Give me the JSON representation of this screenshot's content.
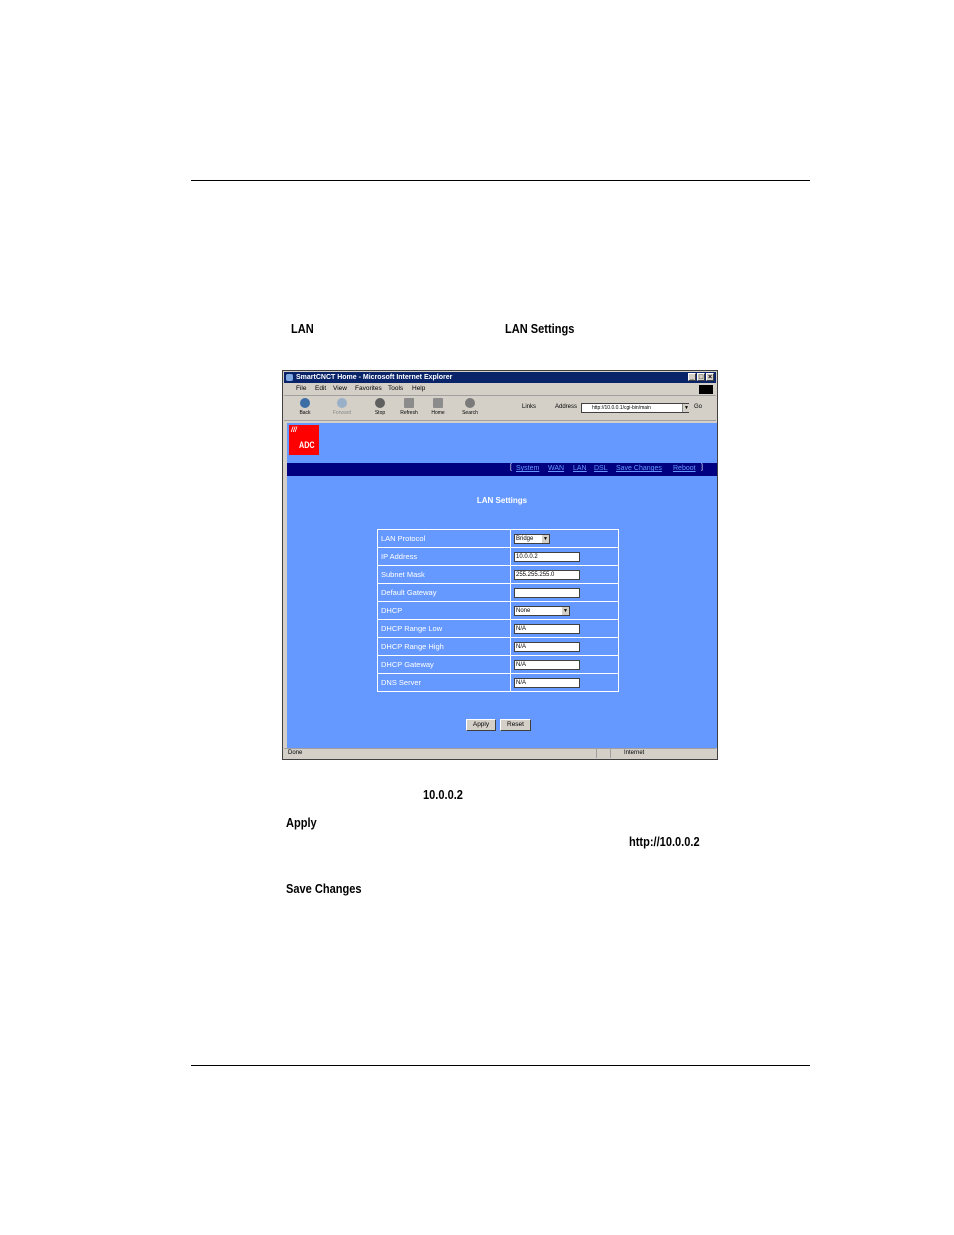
{
  "document": {
    "label_lan": "LAN",
    "label_lan_settings": "LAN Settings",
    "ip_value": "10.0.0.2",
    "apply": "Apply",
    "url": "http://10.0.0.2",
    "save_changes": "Save Changes"
  },
  "browser": {
    "title": "SmartCNCT Home - Microsoft Internet Explorer",
    "menu": [
      "File",
      "Edit",
      "View",
      "Favorites",
      "Tools",
      "Help"
    ],
    "toolbar": {
      "back": "Back",
      "forward": "Forward",
      "stop": "Stop",
      "refresh": "Refresh",
      "home": "Home",
      "search": "Search"
    },
    "links": "Links",
    "address_label": "Address",
    "address": "http://10.0.0.1/cgi-bin/main",
    "go": "Go",
    "status": "Done",
    "zone": "Internet"
  },
  "page": {
    "logo": "ADC",
    "nav": [
      "System",
      "WAN",
      "LAN",
      "DSL",
      "Save Changes",
      "Reboot"
    ],
    "title": "LAN Settings",
    "rows": [
      {
        "label": "LAN Protocol",
        "value": "Bridge",
        "kind": "select"
      },
      {
        "label": "IP Address",
        "value": "10.0.0.2",
        "kind": "text"
      },
      {
        "label": "Subnet Mask",
        "value": "255.255.255.0",
        "kind": "text"
      },
      {
        "label": "Default Gateway",
        "value": "",
        "kind": "text"
      },
      {
        "label": "DHCP",
        "value": "None",
        "kind": "select"
      },
      {
        "label": "DHCP Range Low",
        "value": "N/A",
        "kind": "text"
      },
      {
        "label": "DHCP Range High",
        "value": "N/A",
        "kind": "text"
      },
      {
        "label": "DHCP Gateway",
        "value": "N/A",
        "kind": "text"
      },
      {
        "label": "DNS Server",
        "value": "N/A",
        "kind": "text"
      }
    ],
    "apply": "Apply",
    "reset": "Reset"
  }
}
